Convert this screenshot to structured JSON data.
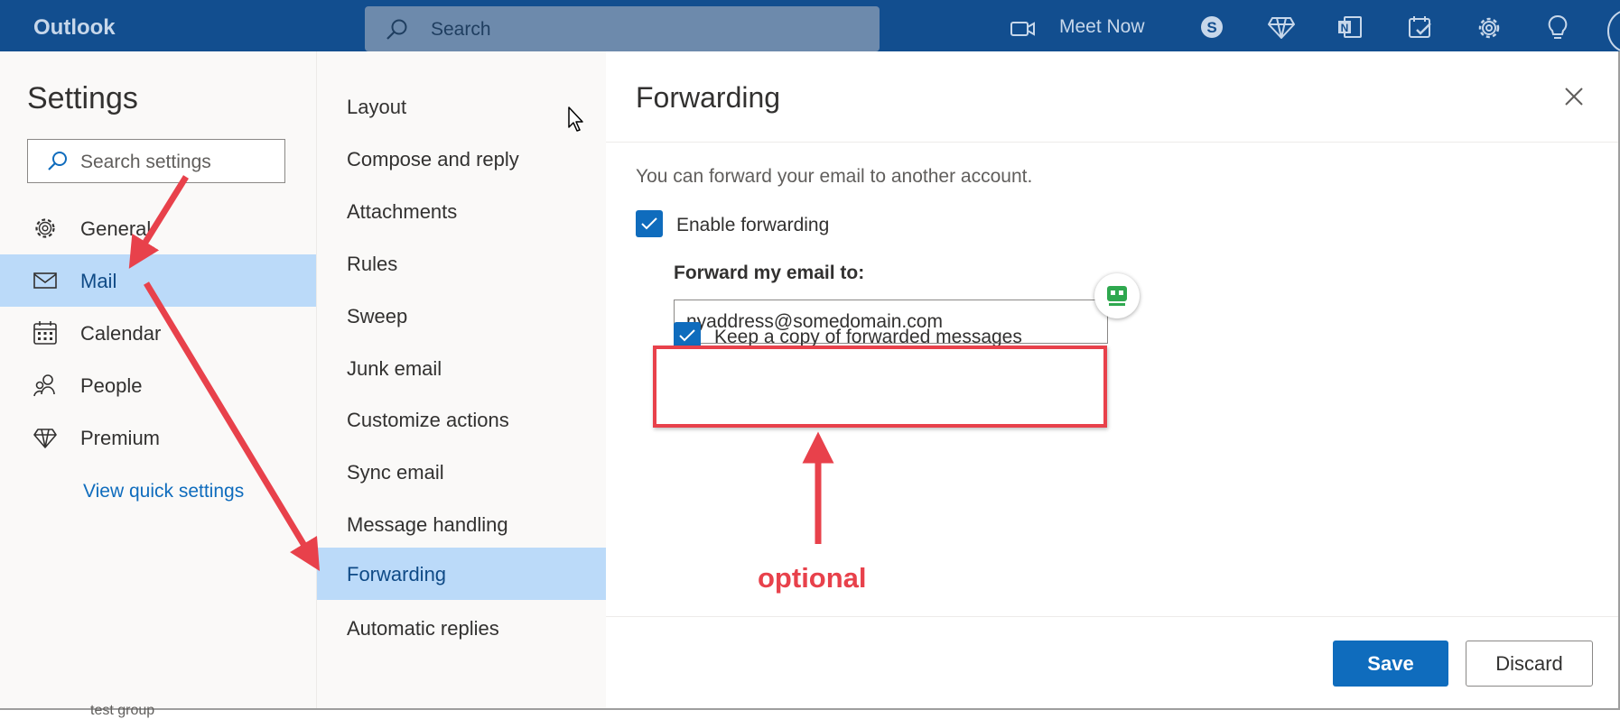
{
  "app": {
    "title": "Outlook"
  },
  "topbar": {
    "search_placeholder": "Search",
    "meet_now_label": "Meet Now",
    "icons": [
      "video-camera-icon",
      "skype-icon",
      "diamond-icon",
      "onenote-icon",
      "todo-icon",
      "gear-icon",
      "lightbulb-icon"
    ]
  },
  "settings": {
    "title": "Settings",
    "search_placeholder": "Search settings",
    "nav": [
      {
        "label": "General",
        "icon": "gear-icon"
      },
      {
        "label": "Mail",
        "icon": "mail-icon",
        "selected": true
      },
      {
        "label": "Calendar",
        "icon": "calendar-icon"
      },
      {
        "label": "People",
        "icon": "people-icon"
      },
      {
        "label": "Premium",
        "icon": "diamond-icon"
      }
    ],
    "quick_settings_link": "View quick settings",
    "cut_bottom_text": "test group"
  },
  "mail_sections": [
    {
      "label": "Layout"
    },
    {
      "label": "Compose and reply"
    },
    {
      "label": "Attachments"
    },
    {
      "label": "Rules"
    },
    {
      "label": "Sweep"
    },
    {
      "label": "Junk email"
    },
    {
      "label": "Customize actions"
    },
    {
      "label": "Sync email"
    },
    {
      "label": "Message handling"
    },
    {
      "label": "Forwarding",
      "selected": true
    },
    {
      "label": "Automatic replies"
    }
  ],
  "forwarding": {
    "title": "Forwarding",
    "description": "You can forward your email to another account.",
    "enable_label": "Enable forwarding",
    "enable_checked": true,
    "forward_to_label": "Forward my email to:",
    "forward_to_value": "nyaddress@somedomain.com",
    "keep_copy_label": "Keep a copy of forwarded messages",
    "keep_copy_checked": true,
    "annotation_text": "optional",
    "save_label": "Save",
    "discard_label": "Discard"
  },
  "colors": {
    "topbar": "#124e8f",
    "accent": "#0f6cbd",
    "selection": "#bbdaf9",
    "annotation": "#e8414b"
  }
}
